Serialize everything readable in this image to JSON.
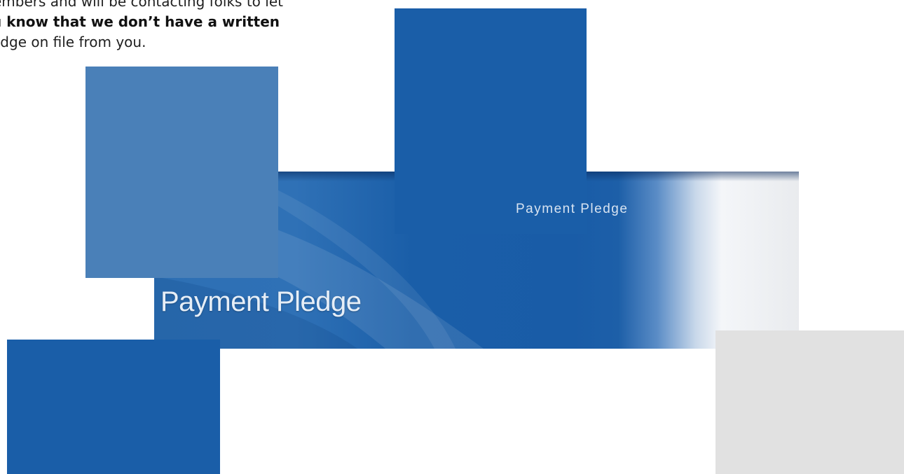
{
  "article": {
    "lines": [
      "embers and will be contacting folks to let",
      "u know that we don’t have a written",
      "edge on file from you."
    ]
  },
  "banner": {
    "title_small": "Payment Pledge",
    "title_large": "Payment Pledge"
  },
  "colors": {
    "brand_blue": "#1a5ea8",
    "light_blue": "#4a80b8",
    "gray": "#e1e1e1"
  }
}
